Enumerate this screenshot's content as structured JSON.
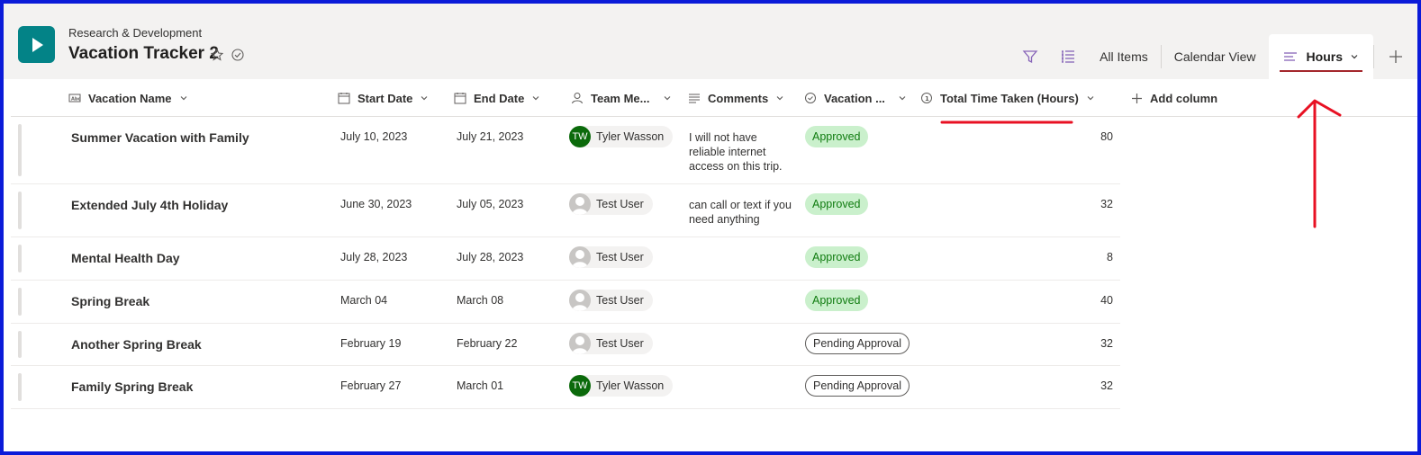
{
  "header": {
    "site_name": "Research & Development",
    "list_title": "Vacation Tracker 2"
  },
  "views": {
    "all_items": "All Items",
    "calendar": "Calendar View",
    "hours": "Hours"
  },
  "columns": {
    "name": "Vacation Name",
    "start": "Start Date",
    "end": "End Date",
    "member": "Team Me...",
    "comments": "Comments",
    "vacation": "Vacation ...",
    "total": "Total Time Taken (Hours)",
    "add": "Add column"
  },
  "rows": [
    {
      "name": "Summer Vacation with Family",
      "start": "July 10, 2023",
      "end": "July 21, 2023",
      "member": "Tyler Wasson",
      "initials": "TW",
      "comment_lines": [
        "I will not have",
        "reliable internet",
        "access on this trip."
      ],
      "status": "Approved",
      "hours": "80"
    },
    {
      "name": "Extended July 4th Holiday",
      "start": "June 30, 2023",
      "end": "July 05, 2023",
      "member": "Test User",
      "initials": "",
      "comment_lines": [
        "can call or text if you",
        "need anything"
      ],
      "status": "Approved",
      "hours": "32"
    },
    {
      "name": "Mental Health Day",
      "start": "July 28, 2023",
      "end": "July 28, 2023",
      "member": "Test User",
      "initials": "",
      "comment_lines": [],
      "status": "Approved",
      "hours": "8"
    },
    {
      "name": "Spring Break",
      "start": "March 04",
      "end": "March 08",
      "member": "Test User",
      "initials": "",
      "comment_lines": [],
      "status": "Approved",
      "hours": "40"
    },
    {
      "name": "Another Spring Break",
      "start": "February 19",
      "end": "February 22",
      "member": "Test User",
      "initials": "",
      "comment_lines": [],
      "status": "Pending Approval",
      "hours": "32"
    },
    {
      "name": "Family Spring Break",
      "start": "February 27",
      "end": "March 01",
      "member": "Tyler Wasson",
      "initials": "TW",
      "comment_lines": [],
      "status": "Pending Approval",
      "hours": "32"
    }
  ],
  "colors": {
    "frame": "#0b1bd9",
    "brand_teal": "#038387",
    "annotation_red": "#e81123",
    "approved_bg": "#caf0cc",
    "approved_text": "#107c10",
    "avatar_green": "#0b6a0b"
  },
  "icons": [
    "app-icon",
    "star-icon",
    "check-circle-icon",
    "filter-icon",
    "list-view-icon",
    "view-lines-icon",
    "chevron-down-icon",
    "plus-icon",
    "text-column-icon",
    "calendar-icon",
    "person-icon",
    "paragraph-icon",
    "choice-icon",
    "number-icon"
  ]
}
